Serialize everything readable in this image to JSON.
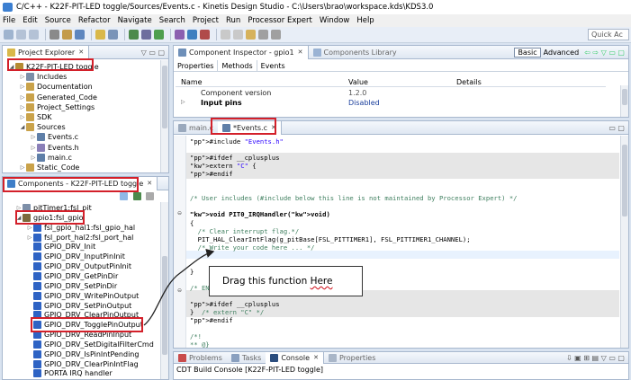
{
  "window": {
    "title": "C/C++ - K22F-PIT-LED toggle/Sources/Events.c - Kinetis Design Studio - C:\\Users\\brao\\workspace.kds\\KDS3.0"
  },
  "menu": [
    "File",
    "Edit",
    "Source",
    "Refactor",
    "Navigate",
    "Search",
    "Project",
    "Run",
    "Processor Expert",
    "Window",
    "Help"
  ],
  "toolbar": {
    "quick_access": "Quick Ac"
  },
  "project_explorer": {
    "tab_label": "Project Explorer",
    "items": [
      {
        "label": "K22F-PIT-LED toggle",
        "level": 0,
        "expanded": true
      },
      {
        "label": "Includes",
        "level": 1
      },
      {
        "label": "Documentation",
        "level": 1
      },
      {
        "label": "Generated_Code",
        "level": 1
      },
      {
        "label": "Project_Settings",
        "level": 1
      },
      {
        "label": "SDK",
        "level": 1
      },
      {
        "label": "Sources",
        "level": 1,
        "expanded": true
      },
      {
        "label": "Events.c",
        "level": 2
      },
      {
        "label": "Events.h",
        "level": 2
      },
      {
        "label": "main.c",
        "level": 2
      },
      {
        "label": "Static_Code",
        "level": 1
      }
    ]
  },
  "components": {
    "tab_label": "Components - K22F-PIT-LED toggle",
    "items": [
      {
        "label": "pitTimer1:fsl_pit",
        "level": 0
      },
      {
        "label": "gpio1:fsl_gpio",
        "level": 0,
        "expanded": true
      },
      {
        "label": "fsl_gpio_hal1:fsl_gpio_hal",
        "level": 1
      },
      {
        "label": "fsl_port_hal2:fsl_port_hal",
        "level": 1
      },
      {
        "label": "GPIO_DRV_Init",
        "level": 1
      },
      {
        "label": "GPIO_DRV_InputPinInit",
        "level": 1
      },
      {
        "label": "GPIO_DRV_OutputPinInit",
        "level": 1
      },
      {
        "label": "GPIO_DRV_GetPinDir",
        "level": 1
      },
      {
        "label": "GPIO_DRV_SetPinDir",
        "level": 1
      },
      {
        "label": "GPIO_DRV_WritePinOutput",
        "level": 1
      },
      {
        "label": "GPIO_DRV_SetPinOutput",
        "level": 1
      },
      {
        "label": "GPIO_DRV_ClearPinOutput",
        "level": 1
      },
      {
        "label": "GPIO_DRV_TogglePinOutput",
        "level": 1
      },
      {
        "label": "GPIO_DRV_ReadPinInput",
        "level": 1
      },
      {
        "label": "GPIO_DRV_SetDigitalFilterCmd",
        "level": 1
      },
      {
        "label": "GPIO_DRV_IsPinIntPending",
        "level": 1
      },
      {
        "label": "GPIO_DRV_ClearPinIntFlag",
        "level": 1
      },
      {
        "label": "PORTA IRQ handler",
        "level": 1
      }
    ]
  },
  "inspector": {
    "tab_label": "Component Inspector - gpio1",
    "tab2_label": "Components Library",
    "basic_label": "Basic",
    "advanced_label": "Advanced",
    "subtabs": [
      "Properties",
      "Methods",
      "Events"
    ],
    "columns": [
      "Name",
      "Value",
      "Details"
    ],
    "rows": [
      {
        "name": "Component version",
        "value": "1.2.0"
      },
      {
        "name": "Input pins",
        "value": "Disabled"
      }
    ]
  },
  "editor": {
    "tabs": [
      {
        "label": "main.c",
        "active": false
      },
      {
        "label": "*Events.c",
        "active": true
      }
    ]
  },
  "code_lines": [
    "#include \"Events.h\"",
    "",
    "#ifdef __cplusplus",
    "extern \"C\" {",
    "#endif",
    "",
    "",
    "/* User includes (#include below this line is not maintained by Processor Expert) */",
    "",
    "void PIT0_IRQHandler(void)",
    "{",
    "  /* Clear interrupt flag.*/",
    "  PIT_HAL_ClearIntFlag(g_pitBase[FSL_PITTIMER1], FSL_PITTIMER1_CHANNEL);",
    "  /* Write your code here ... */",
    "",
    "",
    "}",
    "",
    "/* END",
    "",
    "#ifdef __cplusplus",
    "}  /* extern \"C\" */",
    "#endif",
    "",
    "/*!",
    "** @}"
  ],
  "bottom": {
    "tabs": [
      "Problems",
      "Tasks",
      "Console",
      "Properties"
    ],
    "console_title": "CDT Build Console [K22F-PIT-LED toggle]"
  },
  "callout": {
    "text_prefix": "Drag this function ",
    "text_emph": "Here"
  },
  "colors": {
    "annotation_red": "#d3202a",
    "frame": "#d9e3f0"
  }
}
